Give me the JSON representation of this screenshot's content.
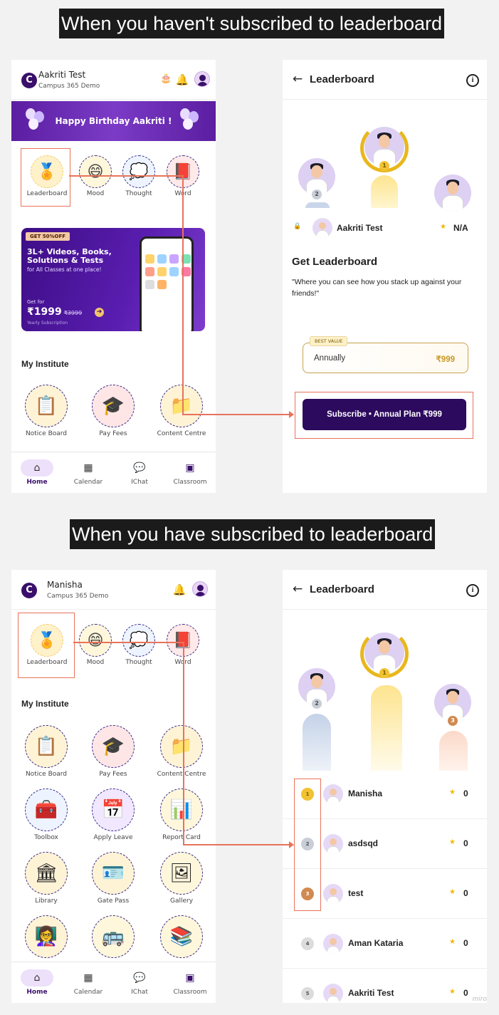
{
  "headings": {
    "top": "When you haven't subscribed to leaderboard",
    "bottom": "When you have subscribed to leaderboard"
  },
  "colors": {
    "brand": "#3a0f6b",
    "accent": "#e8735a",
    "gold": "#f2b705"
  },
  "home1": {
    "user_name": "Aakriti Test",
    "user_sub": "Campus 365 Demo",
    "birthday_text": "Happy Birthday Aakriti !",
    "quick": [
      {
        "label": "Leaderboard",
        "icon": "medal-icon"
      },
      {
        "label": "Mood",
        "icon": "emoji-icon"
      },
      {
        "label": "Thought",
        "icon": "thought-icon"
      },
      {
        "label": "Word",
        "icon": "book-icon"
      }
    ],
    "promo": {
      "tag": "GET 50%OFF",
      "headline": "3L+ Videos, Books, Solutions & Tests",
      "sub": "for All Classes at one place!",
      "get_for": "Get for",
      "price": "₹1999",
      "old_price": "₹3999",
      "period": "Yearly Subscription"
    },
    "institute_title": "My Institute",
    "institute": [
      {
        "label": "Notice Board"
      },
      {
        "label": "Pay Fees"
      },
      {
        "label": "Content Centre"
      }
    ],
    "nav": [
      {
        "label": "Home"
      },
      {
        "label": "Calendar"
      },
      {
        "label": "IChat"
      },
      {
        "label": "Classroom"
      }
    ]
  },
  "lb1": {
    "title": "Leaderboard",
    "me_name": "Aakriti Test",
    "me_score": "N/A",
    "get_title": "Get Leaderboard",
    "get_desc": "\"Where you can see how you stack up against your friends!\"",
    "best_value": "BEST VALUE",
    "plan_label": "Annually",
    "plan_price": "₹999",
    "cta": "Subscribe • Annual Plan ₹999",
    "ranks": [
      "2",
      "1"
    ]
  },
  "home2": {
    "user_name": "Manisha",
    "user_sub": "Campus 365 Demo",
    "quick": [
      {
        "label": "Leaderboard"
      },
      {
        "label": "Mood"
      },
      {
        "label": "Thought"
      },
      {
        "label": "Word"
      }
    ],
    "institute_title": "My Institute",
    "institute": [
      {
        "label": "Notice Board"
      },
      {
        "label": "Pay Fees"
      },
      {
        "label": "Content Centre"
      },
      {
        "label": "Toolbox"
      },
      {
        "label": "Apply Leave"
      },
      {
        "label": "Report Card"
      },
      {
        "label": "Library"
      },
      {
        "label": "Gate Pass"
      },
      {
        "label": "Gallery"
      }
    ],
    "nav": [
      {
        "label": "Home"
      },
      {
        "label": "Calendar"
      },
      {
        "label": "IChat"
      },
      {
        "label": "Classroom"
      }
    ]
  },
  "lb2": {
    "title": "Leaderboard",
    "rows": [
      {
        "rank": "1",
        "name": "Manisha",
        "score": "0"
      },
      {
        "rank": "2",
        "name": "asdsqd",
        "score": "0"
      },
      {
        "rank": "3",
        "name": "test",
        "score": "0"
      },
      {
        "rank": "4",
        "name": "Aman Kataria",
        "score": "0"
      },
      {
        "rank": "5",
        "name": "Aakriti Test",
        "score": "0"
      }
    ],
    "podium_ranks": [
      "2",
      "1",
      "3"
    ]
  },
  "watermark": "miro"
}
